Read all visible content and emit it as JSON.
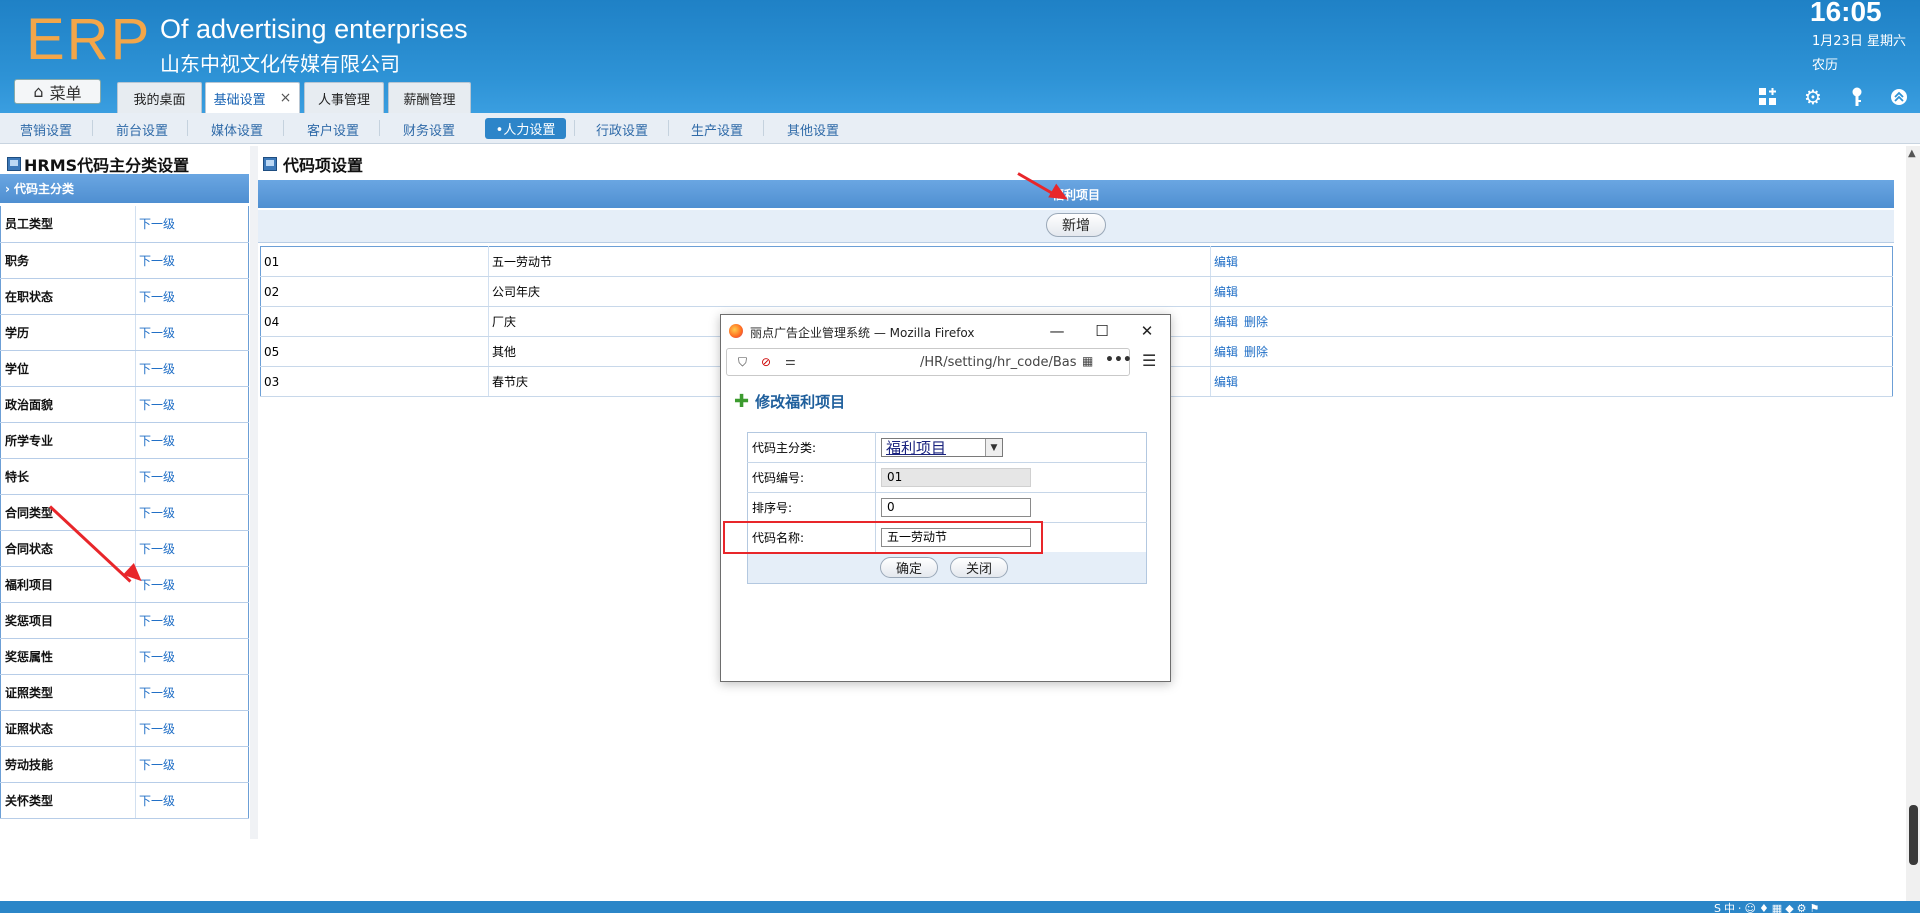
{
  "header": {
    "logo": "ERP",
    "company_en": "Of advertising enterprises",
    "company_cn": "山东中视文化传媒有限公司",
    "clock": "16:05",
    "date": "1月23日 星期六",
    "lunar": "农历",
    "menu_label": "菜单",
    "tabs": [
      {
        "label": "我的桌面"
      },
      {
        "label": "基础设置",
        "close": "×"
      },
      {
        "label": "人事管理"
      },
      {
        "label": "薪酬管理"
      }
    ]
  },
  "subnav": {
    "items": [
      "营销设置",
      "前台设置",
      "媒体设置",
      "客户设置",
      "财务设置",
      "•人力设置",
      "行政设置",
      "生产设置",
      "其他设置"
    ],
    "active_index": 5
  },
  "left": {
    "title": "HRMS代码主分类设置",
    "head": "代码主分类",
    "link_text": "下一级",
    "rows": [
      "员工类型",
      "职务",
      "在职状态",
      "学历",
      "学位",
      "政治面貌",
      "所学专业",
      "特长",
      "合同类型",
      "合同状态",
      "福利项目",
      "奖惩项目",
      "奖惩属性",
      "证照类型",
      "证照状态",
      "劳动技能",
      "关怀类型"
    ]
  },
  "main": {
    "title": "代码项设置",
    "head": "福利项目",
    "add_button": "新增",
    "rows": [
      {
        "code": "01",
        "name": "五一劳动节",
        "actions": [
          "编辑"
        ]
      },
      {
        "code": "02",
        "name": "公司年庆",
        "actions": [
          "编辑"
        ]
      },
      {
        "code": "04",
        "name": "厂庆",
        "actions": [
          "编辑",
          "删除"
        ]
      },
      {
        "code": "05",
        "name": "其他",
        "actions": [
          "编辑",
          "删除"
        ]
      },
      {
        "code": "03",
        "name": "春节庆",
        "actions": [
          "编辑"
        ]
      }
    ]
  },
  "popup": {
    "window_title": "丽点广告企业管理系统 — Mozilla Firefox",
    "url": "/HR/setting/hr_code/Bas",
    "heading": "修改福利项目",
    "fields": {
      "category_label": "代码主分类:",
      "category_value": "福利项目",
      "code_label": "代码编号:",
      "code_value": "01",
      "order_label": "排序号:",
      "order_value": "0",
      "name_label": "代码名称:",
      "name_value": "五一劳动节"
    },
    "ok_button": "确定",
    "close_button": "关闭"
  },
  "colors": {
    "header_blue": "#2e93d6",
    "logo_orange": "#f3a649",
    "link_blue": "#1f6ec6",
    "annotation_red": "#e8262a"
  }
}
